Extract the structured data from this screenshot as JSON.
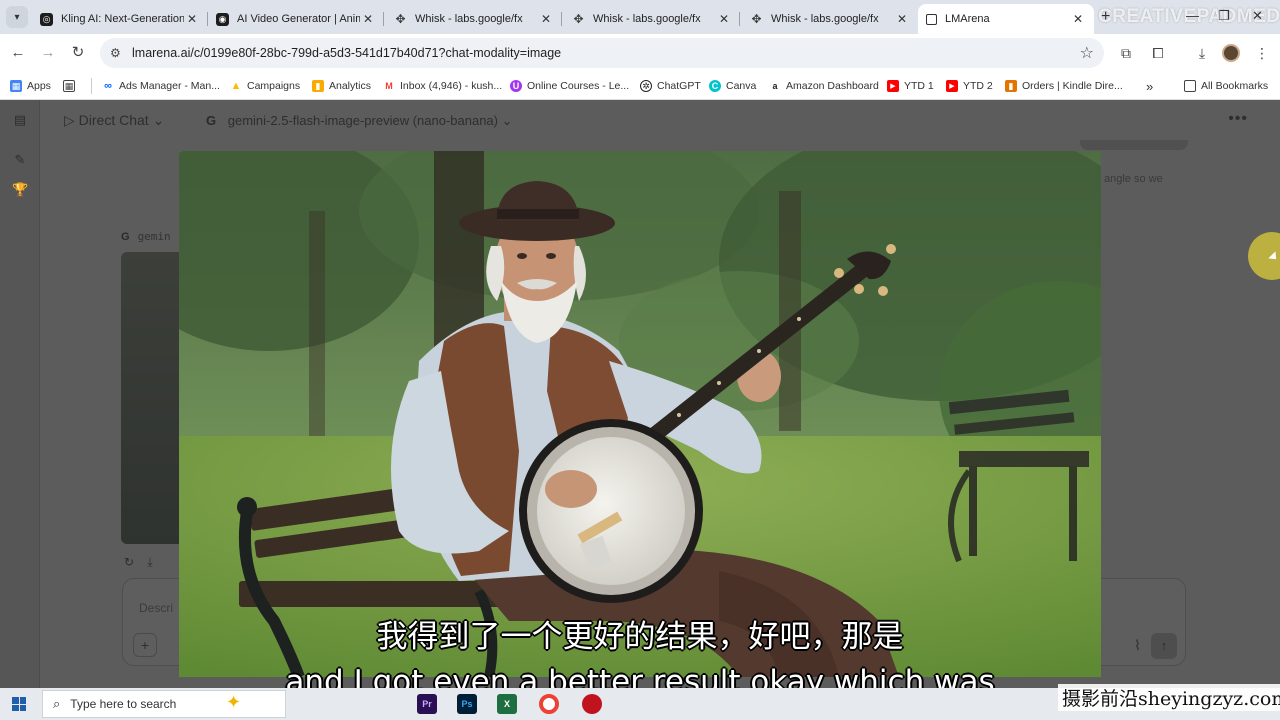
{
  "browser": {
    "tabs": [
      {
        "title": "Kling AI: Next-Generation AI",
        "favicon": "kling-icon"
      },
      {
        "title": "AI Video Generator | Animate",
        "favicon": "aivideo-icon"
      },
      {
        "title": "Whisk - labs.google/fx",
        "favicon": "whisk-icon"
      },
      {
        "title": "Whisk - labs.google/fx",
        "favicon": "whisk-icon"
      },
      {
        "title": "Whisk - labs.google/fx",
        "favicon": "whisk-icon"
      },
      {
        "title": "LMArena",
        "favicon": "lmarena-icon"
      }
    ],
    "watermark": "CREATIVEPADMEDIA",
    "url": "lmarena.ai/c/0199e80f-28bc-799d-a5d3-541d17b40d71?chat-modality=image"
  },
  "bookmarks": [
    {
      "label": "Apps",
      "icon": "apps-grid-icon",
      "color": "#4285f4"
    },
    {
      "label": "Ads Manager - Man...",
      "icon": "meta-icon",
      "color": "#0866ff"
    },
    {
      "label": "Campaigns",
      "icon": "google-ads-icon",
      "color": "#fbbc04"
    },
    {
      "label": "Analytics",
      "icon": "analytics-icon",
      "color": "#f9ab00"
    },
    {
      "label": "Inbox (4,946) - kush...",
      "icon": "gmail-icon",
      "color": "#ea4335"
    },
    {
      "label": "Online Courses - Le...",
      "icon": "udemy-icon",
      "color": "#a435f0"
    },
    {
      "label": "ChatGPT",
      "icon": "chatgpt-icon",
      "color": "#222222"
    },
    {
      "label": "Canva",
      "icon": "canva-icon",
      "color": "#00c4cc"
    },
    {
      "label": "Amazon Dashboard",
      "icon": "amazon-icon",
      "color": "#222222"
    },
    {
      "label": "YTD 1",
      "icon": "youtube-icon",
      "color": "#ff0000"
    },
    {
      "label": "YTD 2",
      "icon": "youtube-icon",
      "color": "#ff0000"
    },
    {
      "label": "Orders | Kindle Dire...",
      "icon": "kindle-chart-icon",
      "color": "#e37400"
    }
  ],
  "bookmarks_more": "»",
  "all_bookmarks": "All Bookmarks",
  "chat": {
    "mode": "Direct Chat",
    "model": "gemini-2.5-flash-image-preview (nano-banana)",
    "user_message_fragment": "angle so we",
    "model_row_label": "gemin",
    "input_placeholder": "Descri"
  },
  "subtitles": {
    "chinese": "我得到了一个更好的结果，好吧，那是",
    "english": "and I got even a better result okay which was"
  },
  "taskbar": {
    "search_placeholder": "Type here to search",
    "apps": [
      {
        "label": "Pr",
        "color": "#2a0f54"
      },
      {
        "label": "Ps",
        "color": "#001e36"
      },
      {
        "label": "X",
        "color": "#1d6f42"
      },
      {
        "label": "",
        "color": "#ea4335"
      },
      {
        "label": "",
        "color": "#c1121f"
      }
    ]
  },
  "watermark_bottom": "摄影前沿sheyingzyz.com"
}
